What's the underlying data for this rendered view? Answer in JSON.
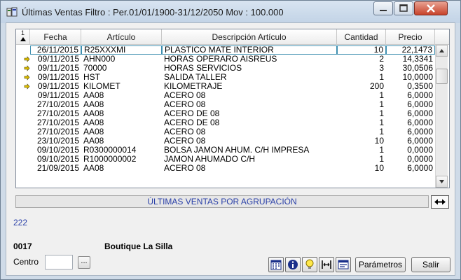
{
  "window": {
    "title": "Últimas Ventas Filtro : Per.01/01/1900-31/12/2050 Mov : 100.000"
  },
  "grid": {
    "corner": "1",
    "columns": [
      "Fecha",
      "Artículo",
      "Descripción Artículo",
      "Cantidad",
      "Precio"
    ],
    "rows": [
      {
        "fecha": "26/11/2015",
        "articulo": "R25XXXMI",
        "descripcion": "PLASTICO MATE INTERIOR",
        "cantidad": "10",
        "precio": "22,1473",
        "marked": false,
        "selected": true
      },
      {
        "fecha": "09/11/2015",
        "articulo": "AHN000",
        "descripcion": "HORAS OPERARO AISREUS",
        "cantidad": "2",
        "precio": "14,3341",
        "marked": true,
        "selected": false
      },
      {
        "fecha": "09/11/2015",
        "articulo": "70000",
        "descripcion": "HORAS SERVICIOS",
        "cantidad": "3",
        "precio": "30,0506",
        "marked": true,
        "selected": false
      },
      {
        "fecha": "09/11/2015",
        "articulo": "HST",
        "descripcion": "SALIDA TALLER",
        "cantidad": "1",
        "precio": "10,0000",
        "marked": true,
        "selected": false
      },
      {
        "fecha": "09/11/2015",
        "articulo": "KILOMET",
        "descripcion": "KILOMETRAJE",
        "cantidad": "200",
        "precio": "0,3500",
        "marked": true,
        "selected": false
      },
      {
        "fecha": "09/11/2015",
        "articulo": "AA08",
        "descripcion": "ACERO 08",
        "cantidad": "1",
        "precio": "6,0000",
        "marked": false,
        "selected": false
      },
      {
        "fecha": "27/10/2015",
        "articulo": "AA08",
        "descripcion": "ACERO 08",
        "cantidad": "1",
        "precio": "6,0000",
        "marked": false,
        "selected": false
      },
      {
        "fecha": "27/10/2015",
        "articulo": "AA08",
        "descripcion": "ACERO DE 08",
        "cantidad": "1",
        "precio": "6,0000",
        "marked": false,
        "selected": false
      },
      {
        "fecha": "27/10/2015",
        "articulo": "AA08",
        "descripcion": "ACERO DE 08",
        "cantidad": "1",
        "precio": "6,0000",
        "marked": false,
        "selected": false
      },
      {
        "fecha": "27/10/2015",
        "articulo": "AA08",
        "descripcion": "ACERO 08",
        "cantidad": "1",
        "precio": "6,0000",
        "marked": false,
        "selected": false
      },
      {
        "fecha": "23/10/2015",
        "articulo": "AA08",
        "descripcion": "ACERO 08",
        "cantidad": "10",
        "precio": "6,0000",
        "marked": false,
        "selected": false
      },
      {
        "fecha": "09/10/2015",
        "articulo": "R0300000014",
        "descripcion": "BOLSA JAMON AHUM. C/H IMPRESA",
        "cantidad": "1",
        "precio": "0,0000",
        "marked": false,
        "selected": false
      },
      {
        "fecha": "09/10/2015",
        "articulo": "R1000000002",
        "descripcion": "JAMON AHUMADO C/H",
        "cantidad": "1",
        "precio": "0,0000",
        "marked": false,
        "selected": false
      },
      {
        "fecha": "21/09/2015",
        "articulo": "AA08",
        "descripcion": "ACERO 08",
        "cantidad": "10",
        "precio": "6,0000",
        "marked": false,
        "selected": false
      }
    ]
  },
  "group_bar": "ÚLTIMAS VENTAS POR AGRUPACIÓN",
  "record_count": "222",
  "store": {
    "code": "0017",
    "name": "Boutique La Silla"
  },
  "centro": {
    "label": "Centro",
    "value": "",
    "browse_label": "..."
  },
  "buttons": {
    "parametros": "Parámetros",
    "salir": "Salir"
  },
  "colors": {
    "accent_blue": "#2a40a8",
    "selection_border": "#3e8fb0",
    "mark_yellow": "#e0c000"
  }
}
